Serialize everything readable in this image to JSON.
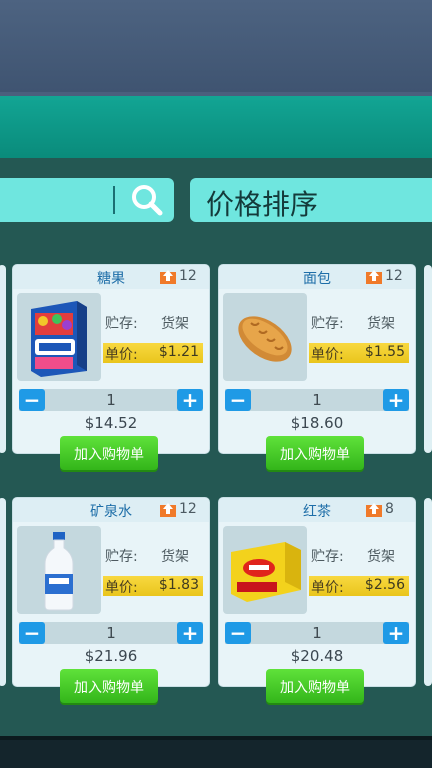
{
  "header": {
    "sort_label": "价格排序"
  },
  "labels": {
    "inventory": "贮存:",
    "unit_price": "单价:",
    "add_to_cart": "加入购物单"
  },
  "products": [
    {
      "name": "糖果",
      "stock": "12",
      "location": "货架",
      "price": "$1.21",
      "quantity": "1",
      "total": "$14.52",
      "image": "candy-box"
    },
    {
      "name": "面包",
      "stock": "12",
      "location": "货架",
      "price": "$1.55",
      "quantity": "1",
      "total": "$18.60",
      "image": "bread-loaf"
    },
    {
      "name": "矿泉水",
      "stock": "12",
      "location": "货架",
      "price": "$1.83",
      "quantity": "1",
      "total": "$21.96",
      "image": "water-bottle"
    },
    {
      "name": "红茶",
      "stock": "8",
      "location": "货架",
      "price": "$2.56",
      "quantity": "1",
      "total": "$20.48",
      "image": "tea-box"
    }
  ],
  "colors": {
    "accent": "#6fe6df",
    "price_bar": "#f0cf2c",
    "add_button": "#45c827",
    "qty_button": "#1f9ae6",
    "panel": "#245853"
  }
}
